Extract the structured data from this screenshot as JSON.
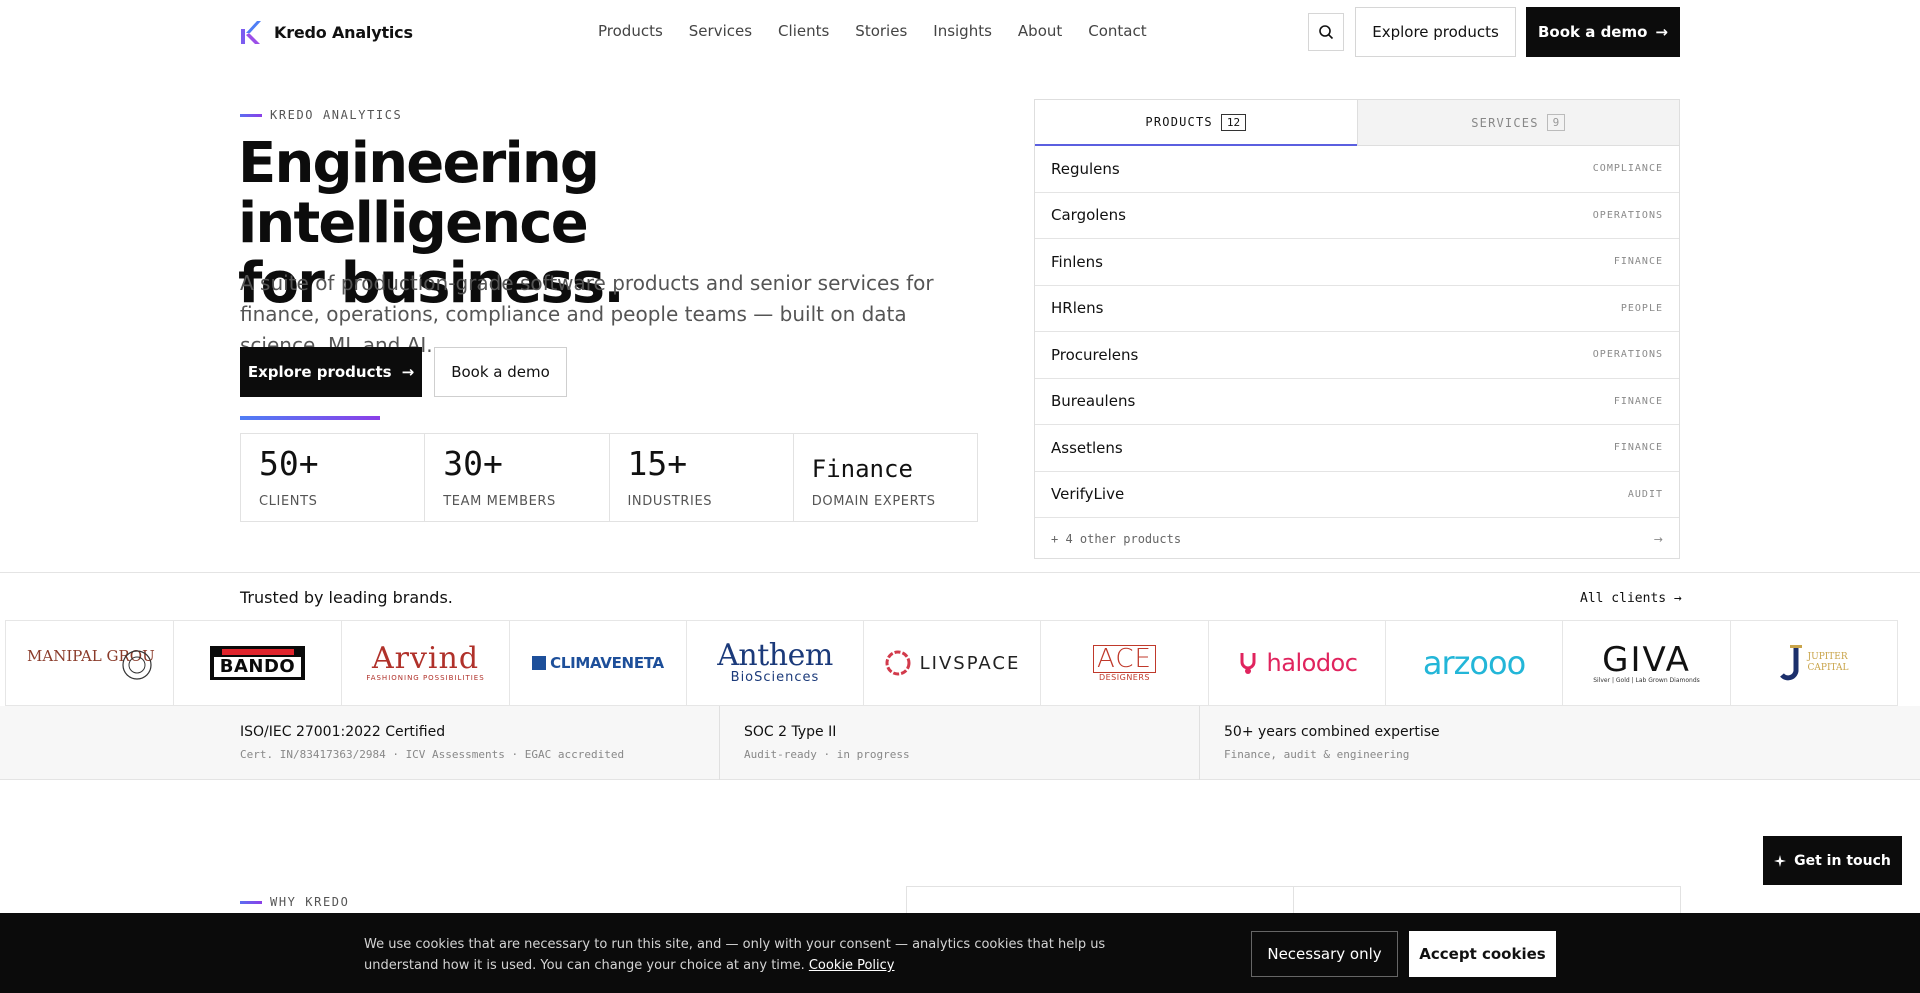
{
  "brand": {
    "name": "Kredo Analytics",
    "logo_icon": "kredo-k-logo"
  },
  "nav": {
    "items": [
      "Products",
      "Services",
      "Clients",
      "Stories",
      "Insights",
      "About",
      "Contact"
    ]
  },
  "header": {
    "search_icon": "search-icon",
    "explore_label": "Explore products",
    "demo_label": "Book a demo",
    "arrow": "→"
  },
  "hero": {
    "eyebrow": "KREDO ANALYTICS",
    "title_line1": "Engineering intelligence",
    "title_line2": "for business.",
    "subtitle": "A suite of production-grade software products and senior services for finance, operations, compliance and people teams — built on data science, ML and AI.",
    "cta_primary": "Explore products",
    "cta_secondary": "Book a demo",
    "arrow": "→"
  },
  "stats": [
    {
      "value": "50+",
      "label": "CLIENTS"
    },
    {
      "value": "30+",
      "label": "TEAM MEMBERS"
    },
    {
      "value": "15+",
      "label": "INDUSTRIES"
    },
    {
      "value": "Finance",
      "label": "DOMAIN EXPERTS"
    }
  ],
  "panel": {
    "tabs": [
      {
        "label": "PRODUCTS",
        "count": "12"
      },
      {
        "label": "SERVICES",
        "count": "9"
      }
    ],
    "products": [
      {
        "name": "Regulens",
        "tag": "COMPLIANCE"
      },
      {
        "name": "Cargolens",
        "tag": "OPERATIONS"
      },
      {
        "name": "Finlens",
        "tag": "FINANCE"
      },
      {
        "name": "HRlens",
        "tag": "PEOPLE"
      },
      {
        "name": "Procurelens",
        "tag": "OPERATIONS"
      },
      {
        "name": "Bureaulens",
        "tag": "FINANCE"
      },
      {
        "name": "Assetlens",
        "tag": "FINANCE"
      },
      {
        "name": "VerifyLive",
        "tag": "AUDIT"
      }
    ],
    "more_label": "+ 4 other products",
    "more_arrow": "→"
  },
  "trusted": {
    "title": "Trusted by leading brands.",
    "all_clients": "All clients →",
    "logos": [
      {
        "name": "MANIPAL GROUP",
        "sub": ""
      },
      {
        "name": "BANDO",
        "sub": ""
      },
      {
        "name": "Arvind",
        "sub": "FASHIONING POSSIBILITIES"
      },
      {
        "name": "CLIMAVENETA",
        "sub": ""
      },
      {
        "name": "Anthem",
        "sub": "BioSciences"
      },
      {
        "name": "LIVSPACE",
        "sub": ""
      },
      {
        "name": "ACE",
        "sub": "DESIGNERS"
      },
      {
        "name": "halodoc",
        "sub": ""
      },
      {
        "name": "arzooo",
        "sub": ""
      },
      {
        "name": "GIVA",
        "sub": "Silver | Gold | Lab Grown Diamonds"
      },
      {
        "name": "JUPITER",
        "sub": "CAPITAL"
      }
    ]
  },
  "certs": [
    {
      "title": "ISO/IEC 27001:2022 Certified",
      "sub": "Cert. IN/83417363/2984 · ICV Assessments · EGAC accredited"
    },
    {
      "title": "SOC 2 Type II",
      "sub": "Audit-ready · in progress"
    },
    {
      "title": "50+ years combined expertise",
      "sub": "Finance, audit & engineering"
    }
  ],
  "why": {
    "eyebrow": "WHY KREDO"
  },
  "get_in_touch": {
    "label": "Get in touch",
    "icon": "sparkle-icon"
  },
  "cookie": {
    "text": "We use cookies that are necessary to run this site, and — only with your consent — analytics cookies that help us understand how it is used. You can change your choice at any time.",
    "link": "Cookie Policy",
    "necessary": "Necessary only",
    "accept": "Accept cookies"
  },
  "colors": {
    "accent": "#5b5fe0",
    "dark": "#0c0c0c",
    "cookie_bg": "#0b0b0b"
  }
}
